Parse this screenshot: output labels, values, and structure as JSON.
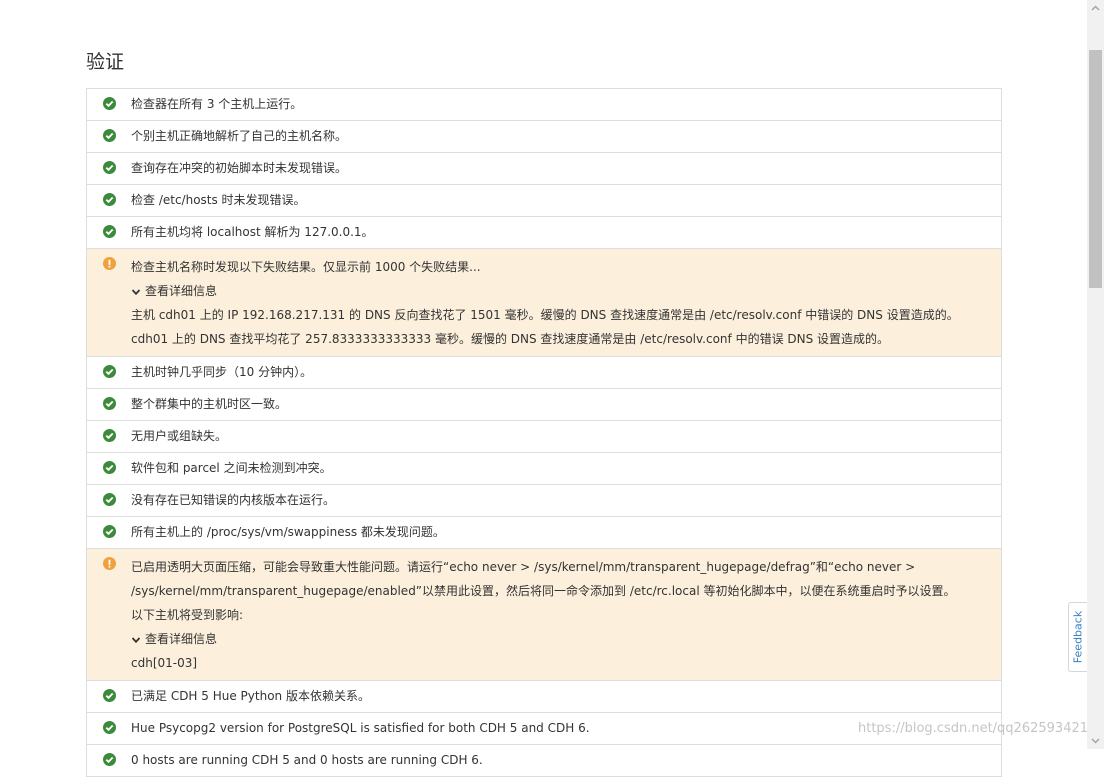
{
  "page": {
    "title": "验证"
  },
  "colors": {
    "ok": "#3c8b3c",
    "warn": "#f0a03c",
    "warn_bg": "#fcf0dc",
    "border": "#dddddd"
  },
  "checks": [
    {
      "status": "ok",
      "text": "检查器在所有 3 个主机上运行。"
    },
    {
      "status": "ok",
      "text": "个别主机正确地解析了自己的主机名称。"
    },
    {
      "status": "ok",
      "text": "查询存在冲突的初始脚本时未发现错误。"
    },
    {
      "status": "ok",
      "text": "检查 /etc/hosts 时未发现错误。"
    },
    {
      "status": "ok",
      "text": "所有主机均将 localhost 解析为 127.0.0.1。"
    },
    {
      "status": "warn",
      "text": "检查主机名称时发现以下失败结果。仅显示前 1000 个失败结果...",
      "detail_label": "查看详细信息",
      "details": [
        "主机 cdh01 上的 IP 192.168.217.131 的 DNS 反向查找花了 1501 毫秒。缓慢的 DNS 查找速度通常是由 /etc/resolv.conf 中错误的 DNS 设置造成的。",
        "cdh01 上的 DNS 查找平均花了 257.8333333333333 毫秒。缓慢的 DNS 查找速度通常是由 /etc/resolv.conf 中的错误 DNS 设置造成的。"
      ]
    },
    {
      "status": "ok",
      "text": "主机时钟几乎同步（10 分钟内）。"
    },
    {
      "status": "ok",
      "text": "整个群集中的主机时区一致。"
    },
    {
      "status": "ok",
      "text": "无用户或组缺失。"
    },
    {
      "status": "ok",
      "text": "软件包和 parcel 之间未检测到冲突。"
    },
    {
      "status": "ok",
      "text": "没有存在已知错误的内核版本在运行。"
    },
    {
      "status": "ok",
      "text": "所有主机上的 /proc/sys/vm/swappiness 都未发现问题。"
    },
    {
      "status": "warn",
      "text_lines": [
        "已启用透明大页面压缩，可能会导致重大性能问题。请运行“echo never > /sys/kernel/mm/transparent_hugepage/defrag”和“echo never >",
        "/sys/kernel/mm/transparent_hugepage/enabled”以禁用此设置，然后将同一命令添加到 /etc/rc.local 等初始化脚本中，以便在系统重启时予以设置。",
        "以下主机将受到影响:"
      ],
      "detail_label": "查看详细信息",
      "details": [
        "cdh[01-03]"
      ]
    },
    {
      "status": "ok",
      "text": "已满足 CDH 5 Hue Python 版本依赖关系。"
    },
    {
      "status": "ok",
      "text": "Hue Psycopg2 version for PostgreSQL is satisfied for both CDH 5 and CDH 6."
    },
    {
      "status": "ok",
      "text": "0 hosts are running CDH 5 and 0 hosts are running CDH 6."
    }
  ],
  "feedback": {
    "label": "Feedback"
  },
  "watermark": "https://blog.csdn.net/qq262593421"
}
